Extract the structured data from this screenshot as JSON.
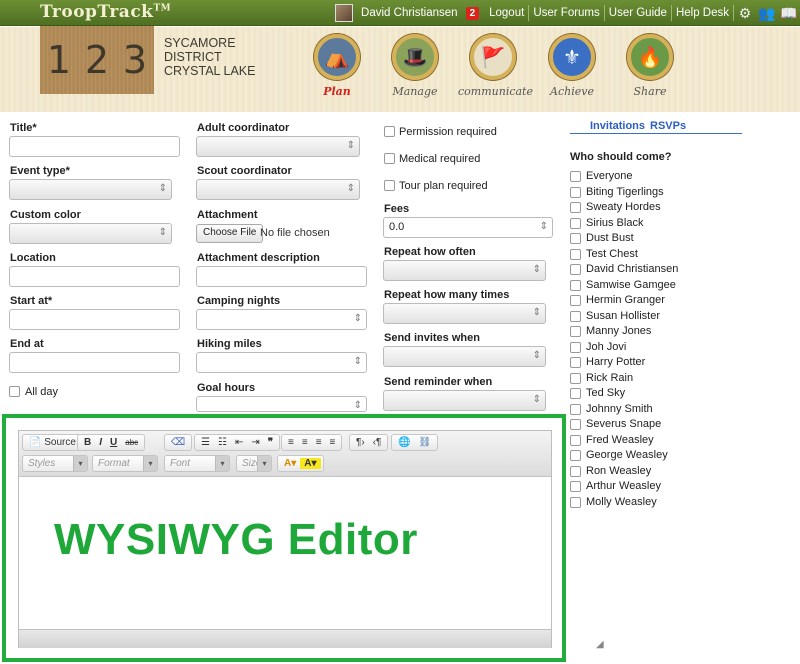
{
  "topbar": {
    "logo": "TroopTrack",
    "logo_tm": "TM",
    "user_name": "David Christiansen",
    "notification_count": "2",
    "links": [
      "Logout",
      "User Forums",
      "User Guide",
      "Help Desk"
    ],
    "icons": [
      "gear-icon",
      "users-icon",
      "book-icon"
    ]
  },
  "header": {
    "troop_digits": [
      "1",
      "2",
      "3"
    ],
    "district_line1": "SYCAMORE",
    "district_line2": "DISTRICT",
    "district_line3": "CRYSTAL LAKE",
    "nav": [
      {
        "label": "Plan",
        "icon": "tent-icon",
        "active": true
      },
      {
        "label": "Manage",
        "icon": "hat-icon",
        "active": false
      },
      {
        "label": "communicate",
        "icon": "flags-icon",
        "active": false
      },
      {
        "label": "Achieve",
        "icon": "fleur-de-lis-icon",
        "active": false
      },
      {
        "label": "Share",
        "icon": "campfire-icon",
        "active": false
      }
    ]
  },
  "form": {
    "title_label": "Title*",
    "event_type_label": "Event type*",
    "custom_color_label": "Custom color",
    "location_label": "Location",
    "start_at_label": "Start at*",
    "end_at_label": "End at",
    "all_day_label": "All day",
    "adult_coordinator_label": "Adult coordinator",
    "scout_coordinator_label": "Scout coordinator",
    "attachment_label": "Attachment",
    "choose_file_label": "Choose File",
    "no_file_text": "No file chosen",
    "attachment_desc_label": "Attachment description",
    "camping_nights_label": "Camping nights",
    "hiking_miles_label": "Hiking miles",
    "goal_hours_label": "Goal hours",
    "permission_label": "Permission required",
    "medical_label": "Medical required",
    "tour_plan_label": "Tour plan required",
    "fees_label": "Fees",
    "fees_value": "0.0",
    "repeat_often_label": "Repeat how often",
    "repeat_times_label": "Repeat how many times",
    "send_invites_label": "Send invites when",
    "send_reminder_label": "Send reminder when"
  },
  "invitations": {
    "tabs": [
      "Invitations",
      "RSVPs"
    ],
    "who_label": "Who should come?",
    "people": [
      "Everyone",
      "Biting Tigerlings",
      "Sweaty Hordes",
      "Sirius Black",
      "Dust Bust",
      "Test Chest",
      "David Christiansen",
      "Samwise Gamgee",
      "Hermin Granger",
      "Susan Hollister",
      "Manny Jones",
      "Joh Jovi",
      "Harry Potter",
      "Rick Rain",
      "Ted Sky",
      "Johnny Smith",
      "Severus Snape",
      "Fred Weasley",
      "George Weasley",
      "Ron Weasley",
      "Arthur Weasley",
      "Molly Weasley"
    ]
  },
  "editor": {
    "source_label": "Source",
    "format_buttons": [
      "B",
      "I",
      "U",
      "abc"
    ],
    "styles_placeholder": "Styles",
    "format_placeholder": "Format",
    "font_placeholder": "Font",
    "size_placeholder": "Size",
    "overlay_label": "WYSIWYG Editor",
    "highlight_color": "#22ad3c"
  }
}
